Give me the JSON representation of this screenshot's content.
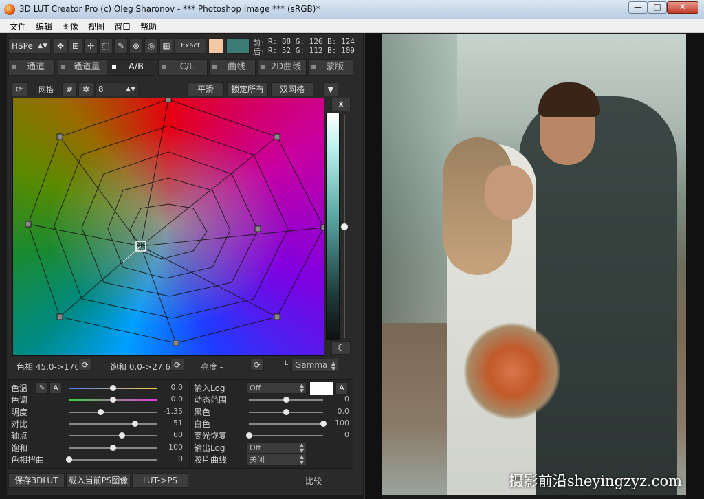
{
  "window": {
    "title": "3D LUT Creator Pro (c) Oleg Sharonov - *** Photoshop Image *** (sRGB)*",
    "min": "—",
    "max": "□",
    "close": "✕"
  },
  "menu": [
    "文件",
    "编辑",
    "图像",
    "视图",
    "窗口",
    "帮助"
  ],
  "toolbar": {
    "mode": "HSPe",
    "exact": "Exact",
    "color_values": {
      "top_prefix": "前:",
      "top": "R:  88   G: 126   B: 124",
      "bottom_prefix": "后:",
      "bottom": "R:  52   G: 112   B: 109"
    },
    "swatch_left": "#f2c9a4",
    "swatch_right": "#3c7a74"
  },
  "tabs": [
    {
      "label": "通道",
      "active": false
    },
    {
      "label": "通道量",
      "active": false
    },
    {
      "label": "A/B",
      "active": true
    },
    {
      "label": "C/L",
      "active": false
    },
    {
      "label": "曲线",
      "active": false
    },
    {
      "label": "2D曲线",
      "active": false
    },
    {
      "label": "蒙版",
      "active": false
    }
  ],
  "grid": {
    "label": "网格",
    "size": "8",
    "smooth": "平滑",
    "lock_all": "锁定所有",
    "double_grid": "双网格"
  },
  "grid_readout": {
    "hue": "色相 45.0->176",
    "saturation": "饱和 0.0->27.6",
    "brightness": "亮度 -",
    "gamma": "Gamma",
    "l_label": "L"
  },
  "left_sliders": [
    {
      "label": "色温",
      "value": "0.0",
      "pos": 0.5
    },
    {
      "label": "色调",
      "value": "0.0",
      "pos": 0.5
    },
    {
      "label": "明度",
      "value": "-1.35",
      "pos": 0.36
    },
    {
      "label": "对比",
      "value": "51",
      "pos": 0.75
    },
    {
      "label": "轴点",
      "value": "60",
      "pos": 0.6
    },
    {
      "label": "饱和",
      "value": "100",
      "pos": 0.5
    },
    {
      "label": "色相扭曲",
      "value": "0",
      "pos": 0.0
    }
  ],
  "right_sliders": [
    {
      "label": "输入Log",
      "value": "Off",
      "type": "select"
    },
    {
      "label": "动态范围",
      "value": "0",
      "pos": 0.5
    },
    {
      "label": "黑色",
      "value": "0.0",
      "pos": 0.5
    },
    {
      "label": "白色",
      "value": "100",
      "pos": 1.0
    },
    {
      "label": "高光恢复",
      "value": "0",
      "pos": 0.0
    },
    {
      "label": "输出Log",
      "value": "Off",
      "type": "select"
    },
    {
      "label": "胶片曲线",
      "value": "关闭",
      "type": "select"
    }
  ],
  "bottom_buttons": {
    "save": "保存3DLUT",
    "load": "载入当前PS图像",
    "lut_ps": "LUT->PS",
    "compare": "比较"
  },
  "watermark": "摄影前沿sheyingzyz.com"
}
